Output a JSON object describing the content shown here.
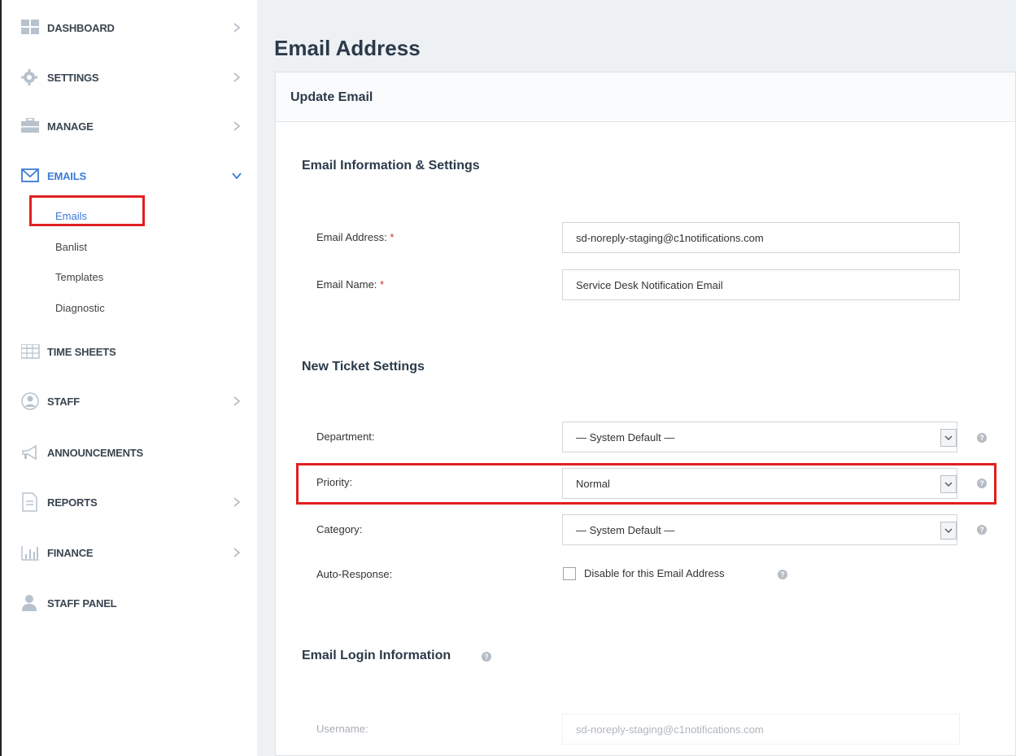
{
  "sidebar": {
    "items": [
      {
        "label": "DASHBOARD",
        "icon": "dashboard-icon"
      },
      {
        "label": "SETTINGS",
        "icon": "gear-icon"
      },
      {
        "label": "MANAGE",
        "icon": "briefcase-icon"
      },
      {
        "label": "EMAILS",
        "icon": "envelope-icon"
      },
      {
        "label": "TIME SHEETS",
        "icon": "grid-icon"
      },
      {
        "label": "STAFF",
        "icon": "user-circle-icon"
      },
      {
        "label": "ANNOUNCEMENTS",
        "icon": "megaphone-icon"
      },
      {
        "label": "REPORTS",
        "icon": "document-icon"
      },
      {
        "label": "FINANCE",
        "icon": "bar-chart-icon"
      },
      {
        "label": "STAFF PANEL",
        "icon": "person-icon"
      }
    ],
    "email_subitems": [
      "Emails",
      "Banlist",
      "Templates",
      "Diagnostic"
    ]
  },
  "page": {
    "title": "Email Address",
    "panel_title": "Update Email"
  },
  "email_info": {
    "section_title": "Email Information & Settings",
    "address_label": "Email Address:",
    "address_value": "sd-noreply-staging@c1notifications.com",
    "name_label": "Email Name:",
    "name_value": "Service Desk Notification Email",
    "required_mark": "*"
  },
  "ticket_settings": {
    "section_title": "New Ticket Settings",
    "department_label": "Department:",
    "department_value": "— System Default —",
    "priority_label": "Priority:",
    "priority_value": "Normal",
    "category_label": "Category:",
    "category_value": "— System Default —",
    "autoresponse_label": "Auto-Response:",
    "autoresponse_checkbox_label": "Disable for this Email Address",
    "autoresponse_checked": false
  },
  "login_info": {
    "section_title": "Email Login Information",
    "username_label": "Username:",
    "username_value": "sd-noreply-staging@c1notifications.com"
  },
  "colors": {
    "accent": "#3b7bd9",
    "highlight": "#e02020",
    "required": "#d0342c"
  }
}
